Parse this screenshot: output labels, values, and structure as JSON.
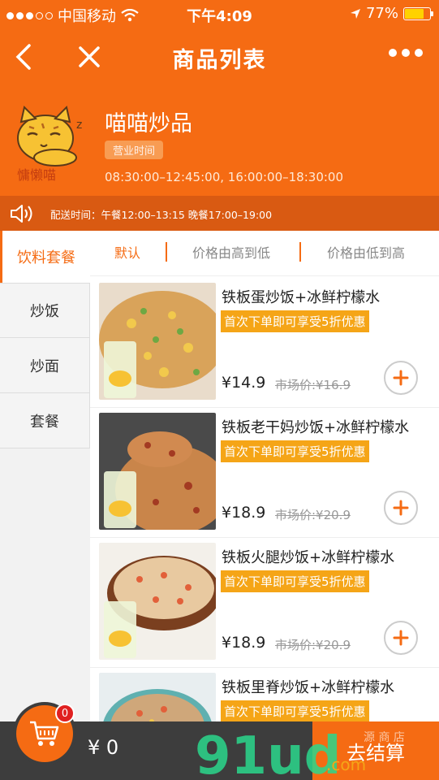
{
  "status": {
    "carrier": "中国移动",
    "time": "下午4:09",
    "battery": "77%",
    "battery_level": 0.77
  },
  "nav": {
    "title": "商品列表"
  },
  "shop": {
    "name": "喵喵炒品",
    "logo_text": "慵懒喵",
    "badge": "营业时间",
    "hours": "08:30:00–12:45:00,  16:00:00–18:30:00"
  },
  "notice": {
    "text": "配送时间：午餐12:00–13:15 晚餐17:00–19:00"
  },
  "categories": [
    "饮料套餐",
    "炒饭",
    "炒面",
    "套餐"
  ],
  "sort": {
    "default": "默认",
    "high_low": "价格由高到低",
    "low_high": "价格由低到高"
  },
  "products": [
    {
      "name": "铁板蛋炒饭+冰鲜柠檬水",
      "promo": "首次下单即可享受5折优惠",
      "price": "¥14.9",
      "original": "市场价:¥16.9"
    },
    {
      "name": "铁板老干妈炒饭+冰鲜柠檬水",
      "promo": "首次下单即可享受5折优惠",
      "price": "¥18.9",
      "original": "市场价:¥20.9"
    },
    {
      "name": "铁板火腿炒饭+冰鲜柠檬水",
      "promo": "首次下单即可享受5折优惠",
      "price": "¥18.9",
      "original": "市场价:¥20.9"
    },
    {
      "name": "铁板里脊炒饭+冰鲜柠檬水",
      "promo": "首次下单即可享受5折优惠",
      "price": "",
      "original": ""
    }
  ],
  "cart": {
    "count": "0",
    "total": "¥ 0",
    "checkout": "去结算"
  },
  "watermark": {
    "text": "91ud",
    "suffix": ".com",
    "small": "源 商 店"
  },
  "colors": {
    "brand": "#f56b13",
    "promo": "#f5a517",
    "cartbar": "#3d3d3d",
    "badge": "#e02020"
  }
}
